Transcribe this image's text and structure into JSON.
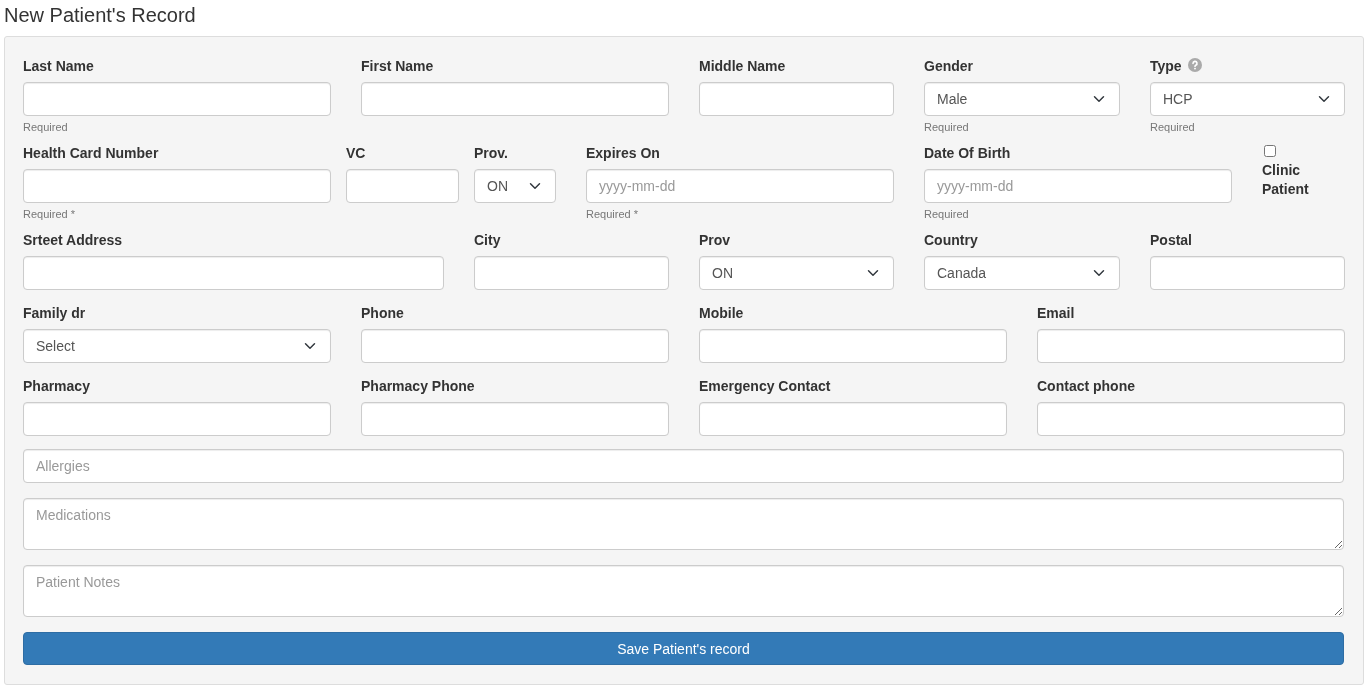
{
  "title": "New Patient's Record",
  "rows": [
    {
      "fields": [
        {
          "kind": "text",
          "label": "Last Name",
          "help": "Required"
        },
        {
          "kind": "text",
          "label": "First Name"
        },
        {
          "kind": "text",
          "label": "Middle Name"
        },
        {
          "kind": "select",
          "label": "Gender",
          "value": "Male",
          "help": "Required"
        },
        {
          "kind": "select",
          "label": "Type",
          "value": "HCP",
          "help": "Required",
          "help_icon": true
        }
      ]
    },
    {
      "fields": [
        {
          "kind": "text",
          "label": "Health Card Number",
          "help": "Required *"
        },
        {
          "kind": "text",
          "label": "VC"
        },
        {
          "kind": "select",
          "label": "Prov.",
          "value": "ON"
        },
        {
          "kind": "text",
          "label": "Expires On",
          "placeholder": "yyyy-mm-dd",
          "help": "Required *"
        },
        {
          "kind": "text",
          "label": "Date Of Birth",
          "placeholder": "yyyy-mm-dd",
          "help": "Required"
        },
        {
          "kind": "checkbox",
          "label": "Clinic Patient",
          "checked": false
        }
      ]
    },
    {
      "fields": [
        {
          "kind": "text",
          "label": "Srteet Address"
        },
        {
          "kind": "text",
          "label": "City"
        },
        {
          "kind": "select",
          "label": "Prov",
          "value": "ON"
        },
        {
          "kind": "select",
          "label": "Country",
          "value": "Canada"
        },
        {
          "kind": "text",
          "label": "Postal"
        }
      ]
    },
    {
      "fields": [
        {
          "kind": "select",
          "label": "Family dr",
          "value": "Select"
        },
        {
          "kind": "text",
          "label": "Phone"
        },
        {
          "kind": "text",
          "label": "Mobile"
        },
        {
          "kind": "text",
          "label": "Email"
        }
      ]
    },
    {
      "fields": [
        {
          "kind": "text",
          "label": "Pharmacy"
        },
        {
          "kind": "text",
          "label": "Pharmacy Phone"
        },
        {
          "kind": "text",
          "label": "Emergency Contact"
        },
        {
          "kind": "text",
          "label": "Contact phone"
        }
      ]
    }
  ],
  "wide_fields": [
    {
      "kind": "input",
      "placeholder": "Allergies"
    },
    {
      "kind": "textarea",
      "placeholder": "Medications"
    },
    {
      "kind": "textarea",
      "placeholder": "Patient Notes"
    }
  ],
  "save_button": "Save Patient's record"
}
